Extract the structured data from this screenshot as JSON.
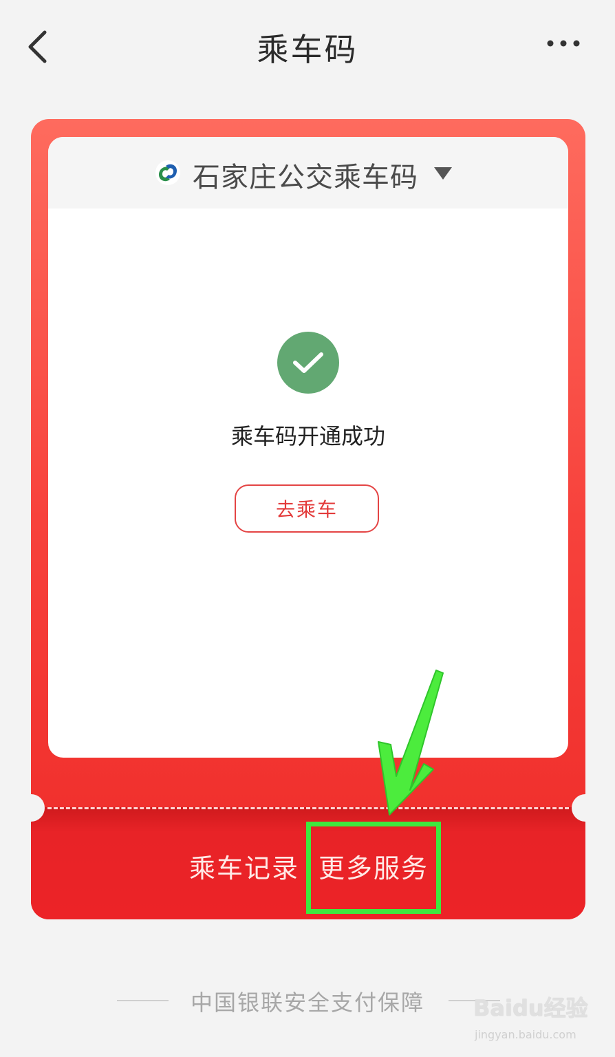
{
  "header": {
    "title": "乘车码"
  },
  "card": {
    "city_name": "石家庄公交乘车码",
    "success_message": "乘车码开通成功",
    "go_ride_label": "去乘车",
    "ride_record_label": "乘车记录",
    "more_services_label": "更多服务"
  },
  "footer": {
    "text": "中国银联安全支付保障"
  },
  "watermark": {
    "brand": "Baidu经验",
    "url": "jingyan.baidu.com"
  },
  "colors": {
    "accent_red": "#ec2327",
    "success_green": "#62a872",
    "annotation_green": "#3ee83e"
  },
  "icons": [
    "back-icon",
    "more-icon",
    "city-bus-logo-icon",
    "dropdown-arrow-icon",
    "check-icon"
  ]
}
